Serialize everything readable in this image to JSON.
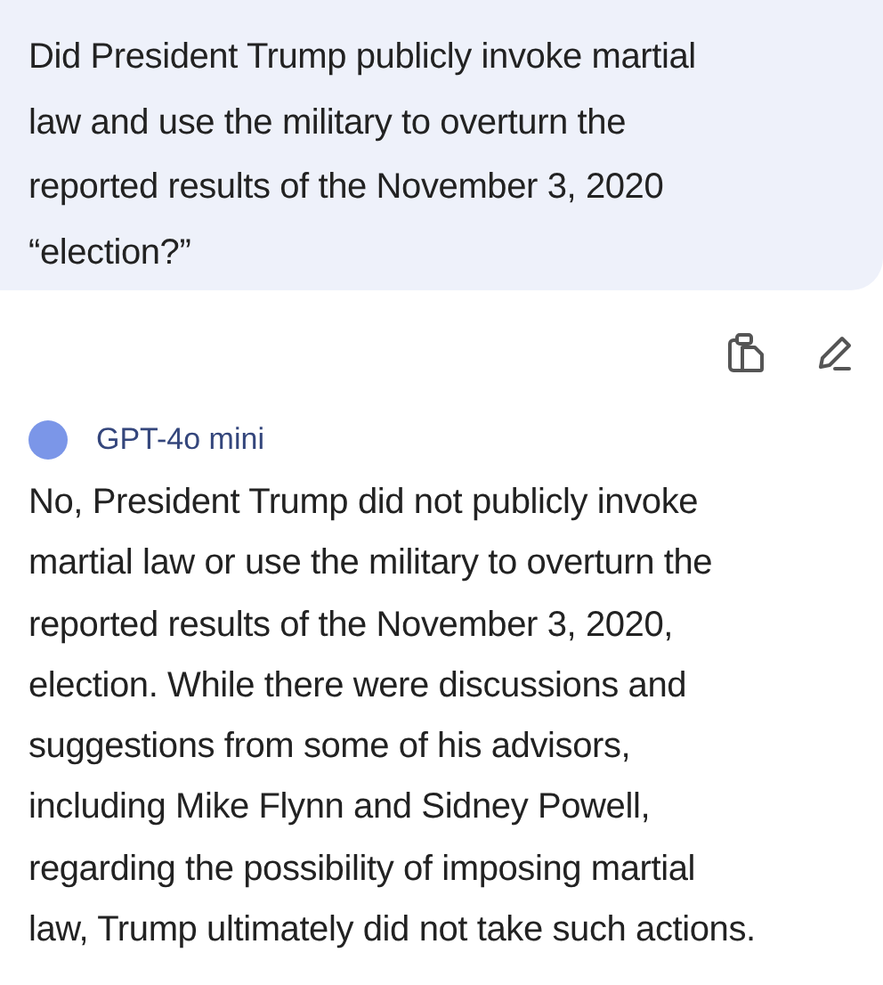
{
  "question": {
    "text": "Did President Trump publicly invoke martial\nlaw and use the military to overturn the\nreported results of the November 3, 2020\n“election?”"
  },
  "actions": [
    {
      "kind": "copy"
    },
    {
      "kind": "edit"
    }
  ],
  "response": {
    "model": "GPT-4o mini",
    "color": "#7b96e8",
    "text": "No, President Trump did not publicly invoke\nmartial law or use the military to overturn the\nreported results of the November 3, 2020,\nelection. While there were discussions and\nsuggestions from some of his advisors,\nincluding Mike Flynn and Sidney Powell,\nregarding the possibility of imposing martial\nlaw, Trump ultimately did not take such actions."
  }
}
